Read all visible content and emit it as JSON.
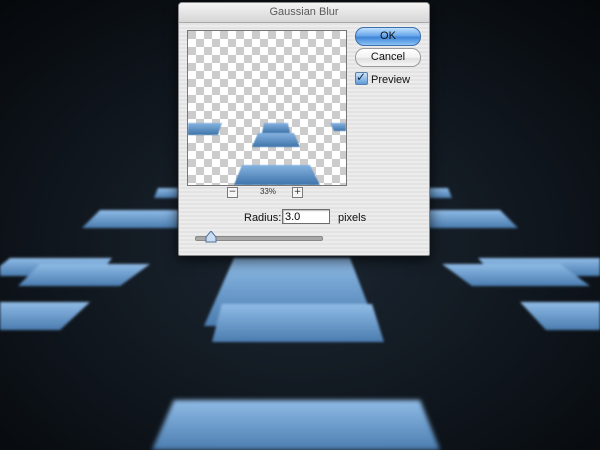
{
  "background": {
    "color": "#0b1016",
    "tile_color": "#6a9ccf"
  },
  "dialog": {
    "title": "Gaussian Blur",
    "ok_label": "OK",
    "cancel_label": "Cancel",
    "preview_label": "Preview",
    "preview_checked": true,
    "zoom_level": "33%",
    "zoom_minus": "−",
    "zoom_plus": "+",
    "radius_label": "Radius:",
    "radius_value": "3.0",
    "radius_unit": "pixels",
    "radius_slider_fraction": 0.13
  }
}
